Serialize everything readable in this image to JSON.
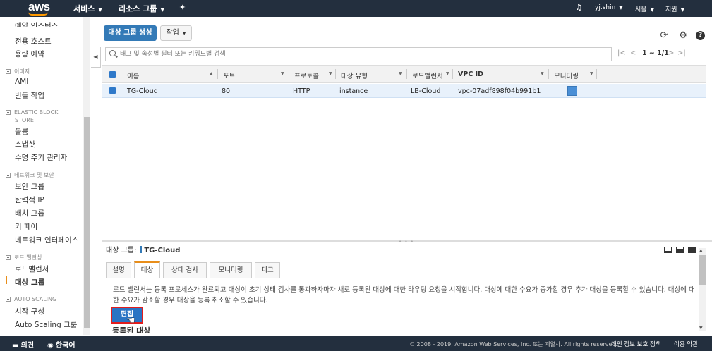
{
  "topbar": {
    "logo": "aws",
    "services": "서비스",
    "resource_groups": "리소스 그룹",
    "user": "yj.shin",
    "region": "서울",
    "support": "지원"
  },
  "sidebar": {
    "items": [
      {
        "label": "예약 인스턴스"
      },
      {
        "label": "전용 호스트"
      },
      {
        "label": "용량 예약"
      },
      {
        "section": "이미지"
      },
      {
        "label": "AMI"
      },
      {
        "label": "번들 작업"
      },
      {
        "section": "ELASTIC BLOCK"
      },
      {
        "section": "STORE"
      },
      {
        "label": "볼륨"
      },
      {
        "label": "스냅샷"
      },
      {
        "label": "수명 주기 관리자"
      },
      {
        "section": "네트워크 및 보안"
      },
      {
        "label": "보안 그룹"
      },
      {
        "label": "탄력적 IP"
      },
      {
        "label": "배치 그룹"
      },
      {
        "label": "키 페어"
      },
      {
        "label": "네트워크 인터페이스"
      },
      {
        "section": "로드 밸런싱"
      },
      {
        "label": "로드밸런서"
      },
      {
        "label": "대상 그룹"
      },
      {
        "section": "AUTO SCALING"
      },
      {
        "label": "시작 구성"
      },
      {
        "label": "Auto Scaling 그룹"
      }
    ]
  },
  "toolbar": {
    "create_label": "대상 그룹 생성",
    "actions_label": "작업"
  },
  "search": {
    "placeholder": "태그 및 속성별 필터 또는 키워드별 검색"
  },
  "pager": {
    "count": "1 ~ 1/1"
  },
  "table": {
    "headers": [
      "이름",
      "포트",
      "프로토콜",
      "대상 유형",
      "로드밸런서",
      "VPC ID",
      "모니터링"
    ],
    "rows": [
      {
        "name": "TG-Cloud",
        "port": "80",
        "protocol": "HTTP",
        "target_type": "instance",
        "load_balancer": "LB-Cloud",
        "vpc_id": "vpc-07adf898f04b991b1"
      }
    ]
  },
  "detail": {
    "title_label": "대상 그룹:",
    "title_value": "TG-Cloud",
    "tabs": [
      "설명",
      "대상",
      "상태 검사",
      "모니터링",
      "태그"
    ],
    "active_tab": "대상",
    "text": "로드 밸런서는 등록 프로세스가 완료되고 대상이 초기 상태 검사를 통과하자마자 새로 등록된 대상에 대한 라우팅 요청을 시작합니다. 대상에 대한 수요가 증가할 경우 추가 대상을 등록할 수 있습니다. 대상에 대한 수요가 감소할 경우 대상을 등록 취소할 수 있습니다.",
    "edit_label": "편집",
    "section_peek": "등록된 대상"
  },
  "footer": {
    "feedback": "의견",
    "language": "한국어",
    "copyright": "© 2008 - 2019, Amazon Web Services, Inc. 또는 계열사. All rights reserved.",
    "privacy": "개인 정보 보호 정책",
    "terms": "이용 약관"
  },
  "colors": {
    "nav_bg": "#232f3e",
    "primary": "#337ab7",
    "accent": "#e88e1a",
    "selected_row": "#e8f1fb",
    "highlight_box": "#e21d1d"
  }
}
